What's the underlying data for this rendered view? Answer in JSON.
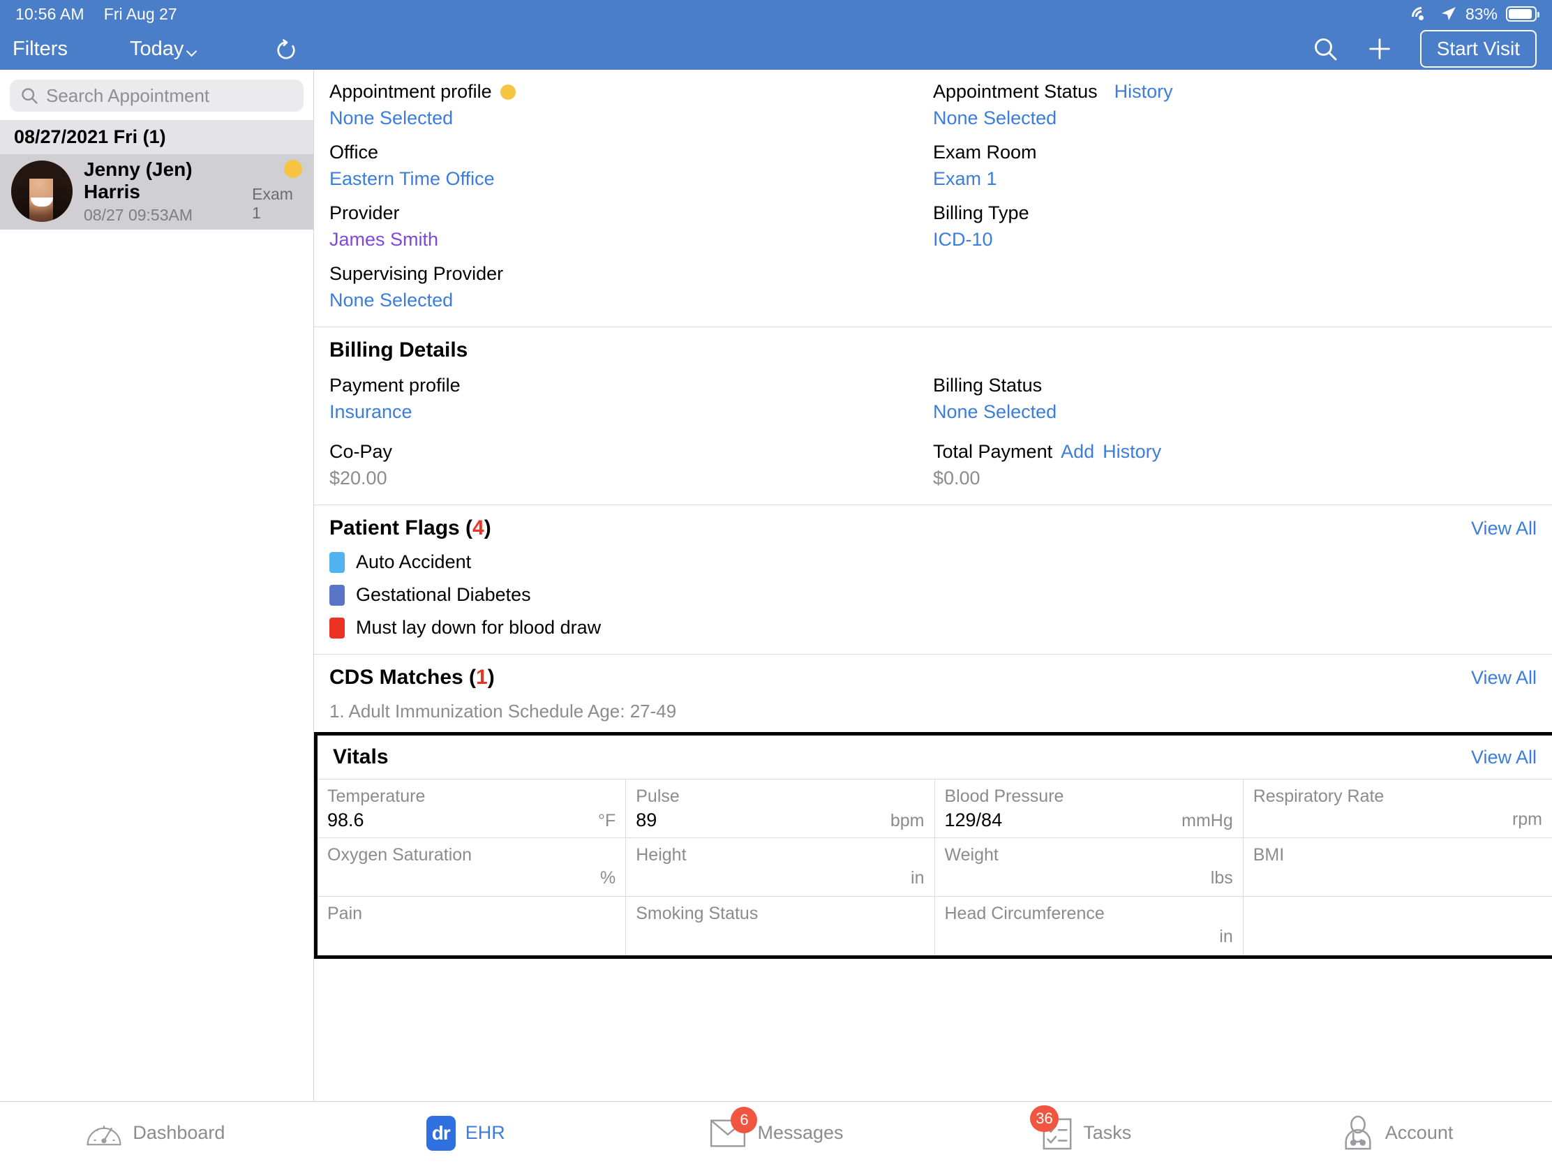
{
  "statusbar": {
    "time": "10:56 AM",
    "date": "Fri Aug 27",
    "battery_pct": "83%",
    "wifi_icon": "wifi-icon",
    "location_icon": "location-arrow-icon",
    "battery_icon": "battery-icon"
  },
  "navbar": {
    "filters": "Filters",
    "today": "Today",
    "refresh_icon": "refresh-icon",
    "search_icon": "search-icon",
    "add_icon": "plus-icon",
    "start_visit": "Start Visit"
  },
  "sidebar": {
    "search_placeholder": "Search Appointment",
    "search_icon": "search-icon",
    "day_header": "08/27/2021 Fri (1)",
    "appointments": [
      {
        "name": "Jenny (Jen) Harris",
        "time": "08/27 09:53AM",
        "room": "Exam 1",
        "status_dot": "#f5c443"
      }
    ]
  },
  "appointment_details": {
    "left": [
      {
        "label": "Appointment profile",
        "value": "None Selected",
        "has_dot": true,
        "dot_color": "#f5c443"
      },
      {
        "label": "Office",
        "value": "Eastern Time Office"
      },
      {
        "label": "Provider",
        "value": "James Smith",
        "style": "purple"
      },
      {
        "label": "Supervising Provider",
        "value": "None Selected"
      }
    ],
    "right": [
      {
        "label": "Appointment Status",
        "link": "History",
        "value": "None Selected"
      },
      {
        "label": "Exam Room",
        "value": "Exam 1"
      },
      {
        "label": "Billing Type",
        "value": "ICD-10"
      }
    ]
  },
  "billing_details": {
    "title": "Billing Details",
    "payment_profile_label": "Payment profile",
    "payment_profile_value": "Insurance",
    "billing_status_label": "Billing Status",
    "billing_status_value": "None Selected",
    "copay_label": "Co-Pay",
    "copay_value": "$20.00",
    "total_payment_label": "Total Payment",
    "total_payment_add": "Add",
    "total_payment_history": "History",
    "total_payment_value": "$0.00"
  },
  "patient_flags": {
    "title": "Patient Flags (",
    "count": "4",
    "title_end": ")",
    "view_all": "View All",
    "items": [
      {
        "label": "Auto Accident",
        "color": "#4fb3f0"
      },
      {
        "label": "Gestational Diabetes",
        "color": "#5a74c8"
      },
      {
        "label": "Must lay down for blood draw",
        "color": "#ec3223"
      }
    ]
  },
  "cds_matches": {
    "title": "CDS Matches (",
    "count": "1",
    "title_end": ")",
    "view_all": "View All",
    "items": [
      "1. Adult Immunization Schedule Age: 27-49"
    ]
  },
  "vitals": {
    "title": "Vitals",
    "view_all": "View All",
    "cells": [
      {
        "label": "Temperature",
        "value": "98.6",
        "unit": "°F"
      },
      {
        "label": "Pulse",
        "value": "89",
        "unit": "bpm"
      },
      {
        "label": "Blood Pressure",
        "value": "129/84",
        "unit": "mmHg"
      },
      {
        "label": "Respiratory Rate",
        "value": "",
        "unit": "rpm"
      },
      {
        "label": "Oxygen Saturation",
        "value": "",
        "unit": "%"
      },
      {
        "label": "Height",
        "value": "",
        "unit": "in"
      },
      {
        "label": "Weight",
        "value": "",
        "unit": "lbs"
      },
      {
        "label": "BMI",
        "value": "",
        "unit": ""
      },
      {
        "label": "Pain",
        "value": "",
        "unit": ""
      },
      {
        "label": "Smoking Status",
        "value": "",
        "unit": ""
      },
      {
        "label": "Head Circumference",
        "value": "",
        "unit": "in"
      },
      {
        "label": "",
        "value": "",
        "unit": ""
      }
    ]
  },
  "tabbar": {
    "tabs": [
      {
        "label": "Dashboard",
        "icon": "dashboard-gauge-icon",
        "badge": "",
        "active": false
      },
      {
        "label": "EHR",
        "icon": "ehr-dr-icon",
        "badge": "",
        "active": true
      },
      {
        "label": "Messages",
        "icon": "envelope-icon",
        "badge": "6",
        "active": false
      },
      {
        "label": "Tasks",
        "icon": "checklist-icon",
        "badge": "36",
        "active": false
      },
      {
        "label": "Account",
        "icon": "doctor-avatar-icon",
        "badge": "",
        "active": false
      }
    ]
  },
  "colors": {
    "brand_blue": "#4a7ec9",
    "link_blue": "#3b7ddd",
    "accent_purple": "#8048d8",
    "alert_red": "#e8352a",
    "badge_red": "#f05540",
    "status_yellow": "#f5c443"
  }
}
